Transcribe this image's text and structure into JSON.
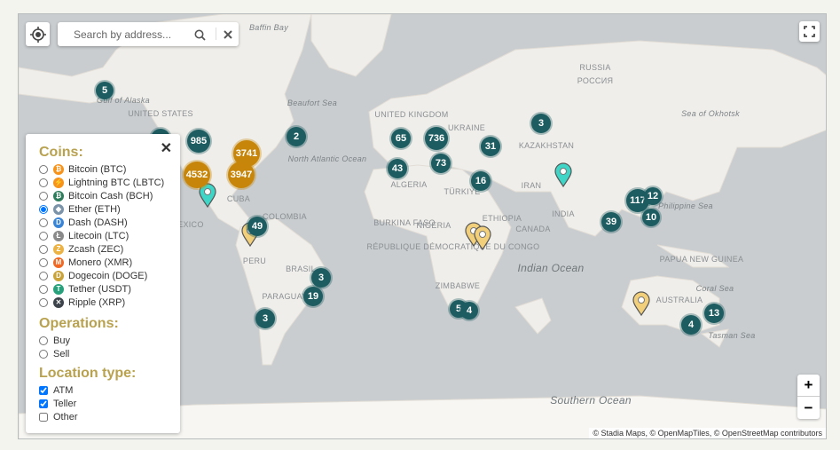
{
  "search": {
    "placeholder": "Search by address..."
  },
  "panel": {
    "coins_title": "Coins:",
    "coins": [
      {
        "label": "Bitcoin (BTC)",
        "color": "#f7931a",
        "glyph": "₿",
        "selected": false
      },
      {
        "label": "Lightning BTC (LBTC)",
        "color": "#f7931a",
        "glyph": "⚡",
        "selected": false
      },
      {
        "label": "Bitcoin Cash (BCH)",
        "color": "#2f7c5c",
        "glyph": "₿",
        "selected": false
      },
      {
        "label": "Ether (ETH)",
        "color": "#7b93a8",
        "glyph": "◆",
        "selected": true
      },
      {
        "label": "Dash (DASH)",
        "color": "#3a84d6",
        "glyph": "D",
        "selected": false
      },
      {
        "label": "Litecoin (LTC)",
        "color": "#8a8a8a",
        "glyph": "Ł",
        "selected": false
      },
      {
        "label": "Zcash (ZEC)",
        "color": "#ecb244",
        "glyph": "Z",
        "selected": false
      },
      {
        "label": "Monero (XMR)",
        "color": "#f26822",
        "glyph": "M",
        "selected": false
      },
      {
        "label": "Dogecoin (DOGE)",
        "color": "#c9a33a",
        "glyph": "D",
        "selected": false
      },
      {
        "label": "Tether (USDT)",
        "color": "#26a17b",
        "glyph": "T",
        "selected": false
      },
      {
        "label": "Ripple (XRP)",
        "color": "#3c434a",
        "glyph": "✕",
        "selected": false
      }
    ],
    "operations_title": "Operations:",
    "operations": [
      {
        "label": "Buy",
        "selected": false
      },
      {
        "label": "Sell",
        "selected": false
      }
    ],
    "location_title": "Location type:",
    "locations": [
      {
        "label": "ATM",
        "checked": true
      },
      {
        "label": "Teller",
        "checked": true
      },
      {
        "label": "Other",
        "checked": false
      }
    ]
  },
  "clusters": [
    "5",
    "985",
    "3741",
    "4532",
    "3947",
    "2",
    "49",
    "65",
    "736",
    "31",
    "3",
    "43",
    "73",
    "16",
    "117",
    "12",
    "10",
    "39",
    "3",
    "19",
    "3",
    "5",
    "4",
    "4",
    "13",
    ""
  ],
  "map_labels": [
    "Baffin Bay",
    "Beaufort Sea",
    "CANADA",
    "Gulf of Alaska",
    "UNITED STATES",
    "MEXICO",
    "CUBA",
    "COLOMBIA",
    "North Atlantic Ocean",
    "UNITED KINGDOM",
    "UKRAINE",
    "KAZAKHSTAN",
    "RUSSIA",
    "РОССИЯ",
    "Sea of Okhotsk",
    "ALGERIA",
    "TÜRKIYE",
    "IRAN",
    "INDIA",
    "ETHIOPIA",
    "BURKINA FASO",
    "NIGERIA",
    "RÉPUBLIQUE DÉMOCRATIQUE DU CONGO",
    "ZIMBABWE",
    "Indian Ocean",
    "AUSTRALIA",
    "Coral Sea",
    "Tasman Sea",
    "Southern Ocean",
    "PERU",
    "BRASIL",
    "PARAGUAY",
    "Philippine Sea",
    "PAPUA NEW GUINEA"
  ],
  "attribution": "© Stadia Maps, © OpenMapTiles, © OpenStreetMap contributors",
  "zoom": {
    "in": "+",
    "out": "−"
  },
  "colors": {
    "cluster": "#1d5c60",
    "cluster_large": "#c7860a",
    "pin_teal": "#3fd6c8",
    "pin_yellow": "#f2cf7a",
    "land": "#f0eeea",
    "water": "#c9cdcf",
    "heading": "#b9a24f"
  }
}
